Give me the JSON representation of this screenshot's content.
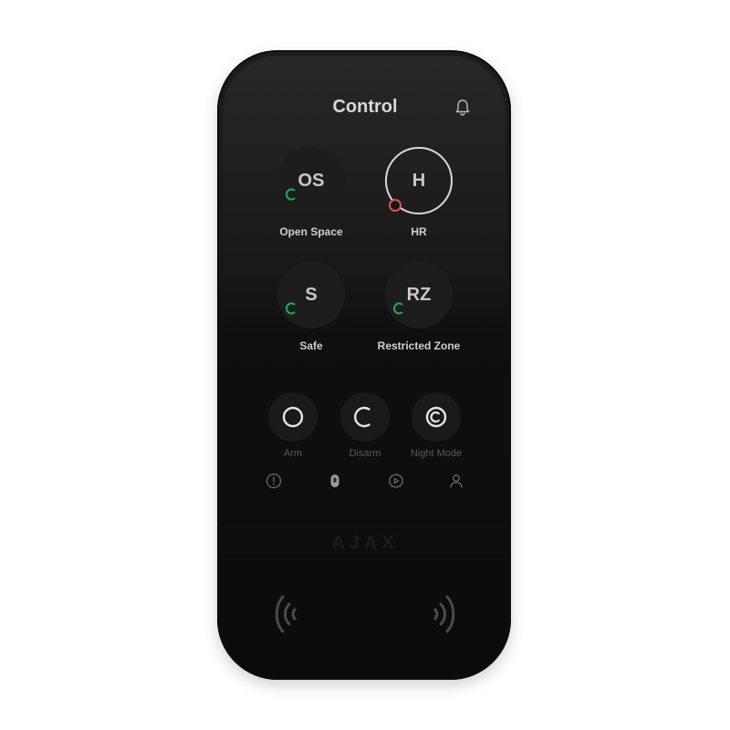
{
  "header": {
    "title": "Control",
    "bell_icon": "bell-icon"
  },
  "groups": [
    {
      "abbr": "OS",
      "name": "Open Space",
      "status": "disarmed",
      "status_color": "#1fae5b",
      "active": false
    },
    {
      "abbr": "H",
      "name": "HR",
      "status": "armed",
      "status_color": "#d9534f",
      "active": true
    },
    {
      "abbr": "S",
      "name": "Safe",
      "status": "disarmed",
      "status_color": "#1fae5b",
      "active": false
    },
    {
      "abbr": "RZ",
      "name": "Restricted Zone",
      "status": "disarmed",
      "status_color": "#1fae5b",
      "active": false
    }
  ],
  "actions": [
    {
      "label": "Arm",
      "icon": "arm-icon"
    },
    {
      "label": "Disarm",
      "icon": "disarm-icon"
    },
    {
      "label": "Night Mode",
      "icon": "night-mode-icon"
    }
  ],
  "nav": [
    {
      "icon": "alarm-icon",
      "selected": false
    },
    {
      "icon": "control-icon",
      "selected": true
    },
    {
      "icon": "scenarios-icon",
      "selected": false
    },
    {
      "icon": "user-icon",
      "selected": false
    }
  ],
  "brand": "AJAX",
  "colors": {
    "device": "#141414",
    "text": "#d8d8d8",
    "disarmed": "#1fae5b",
    "armed": "#d9534f"
  }
}
